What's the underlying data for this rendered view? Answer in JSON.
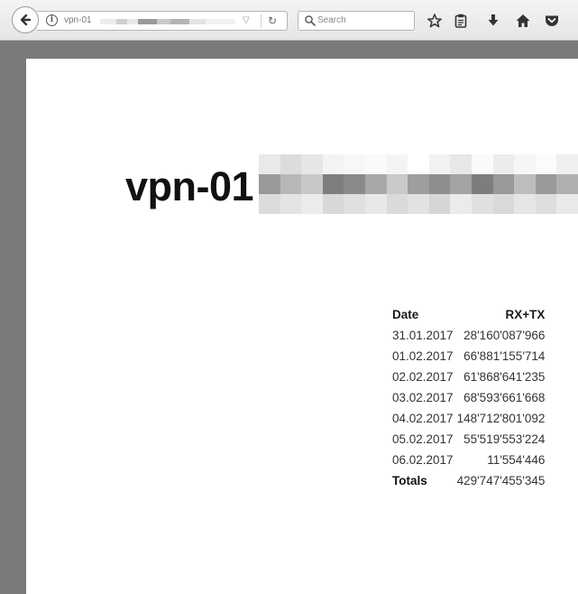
{
  "browser": {
    "url_text": "vpn-01",
    "search_placeholder": "Search"
  },
  "icons": {
    "back": "back-arrow-icon",
    "info": "info-icon",
    "dropdown": "dropdown-arrow-icon",
    "reload": "reload-icon",
    "search": "search-icon",
    "bookmark": "star-icon",
    "reading_list": "clipboard-icon",
    "downloads": "download-arrow-icon",
    "home": "home-icon",
    "pocket": "pocket-icon"
  },
  "page": {
    "title": "vpn-01"
  },
  "report": {
    "headers": {
      "date": "Date",
      "total": "RX+TX"
    },
    "rows": [
      {
        "date": "31.01.2017",
        "value": "28'160'087'966"
      },
      {
        "date": "01.02.2017",
        "value": "66'881'155'714"
      },
      {
        "date": "02.02.2017",
        "value": "61'868'641'235"
      },
      {
        "date": "03.02.2017",
        "value": "68'593'661'668"
      },
      {
        "date": "04.02.2017",
        "value": "148'712'801'092"
      },
      {
        "date": "05.02.2017",
        "value": "55'519'553'224"
      },
      {
        "date": "06.02.2017",
        "value": "11'554'446"
      }
    ],
    "totals": {
      "label": "Totals",
      "value": "429'747'455'345"
    }
  }
}
